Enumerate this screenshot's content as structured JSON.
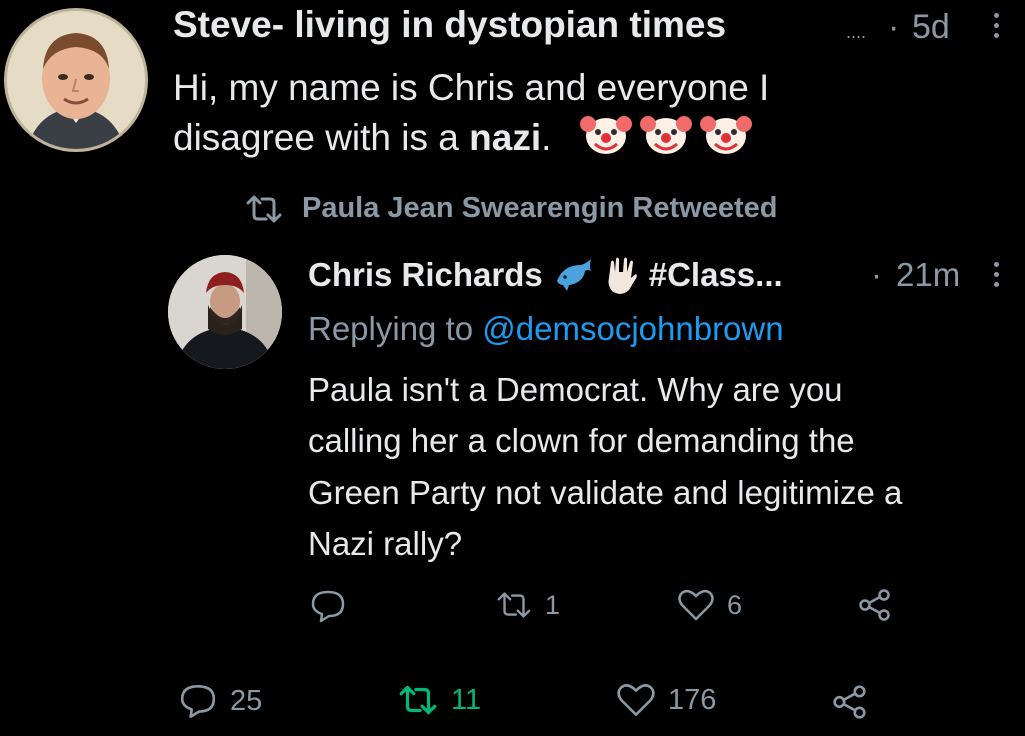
{
  "outer_tweet": {
    "author": "Steve- living in dystopian times",
    "ellipsis": "....",
    "separator": "·",
    "time": "5d",
    "text_line1": "Hi, my name is Chris and everyone I",
    "text_line2_a": "disagree with is a",
    "text_line2_bold": "nazi",
    "text_line2_end": ".",
    "emojis": [
      "clown-face",
      "clown-face",
      "clown-face"
    ],
    "actions": {
      "replies": "25",
      "retweets": "11",
      "likes": "176"
    },
    "colors": {
      "retweet_active": "#00ba7c"
    }
  },
  "retweet_banner": {
    "text": "Paula Jean Swearengin Retweeted"
  },
  "quoted_tweet": {
    "author": "Chris Richards",
    "author_emojis": [
      "dolphin",
      "vulcan-salute"
    ],
    "author_tag": "#Class...",
    "separator": "·",
    "time": "21m",
    "replying_prefix": "Replying to",
    "replying_handle": "@demsocjohnbrown",
    "text_lines": [
      "Paula isn't a Democrat. Why are you",
      "calling her a clown for demanding the",
      "Green Party not validate and legitimize a",
      "Nazi rally?"
    ],
    "actions": {
      "replies": "",
      "retweets": "1",
      "likes": "6"
    },
    "colors": {
      "link": "#1d9bf0"
    }
  }
}
